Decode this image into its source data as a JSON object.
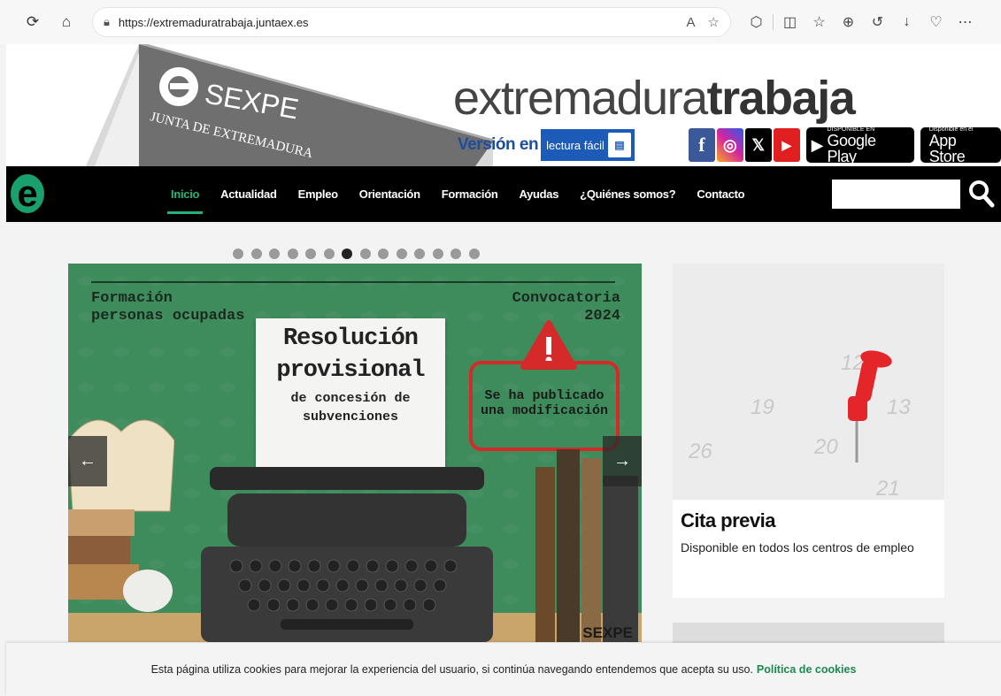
{
  "browser": {
    "url": "https://extremaduratrabaja.juntaex.es"
  },
  "header": {
    "brand_light": "extremadura",
    "brand_bold": "trabaja",
    "sign_line1": "SEXPE",
    "sign_line2": "JUNTA DE EXTREMADURA",
    "easy_read_prefix": "Versión en",
    "easy_read_badge": "lectura fácil",
    "google_small": "DISPONIBLE EN",
    "google_big": "Google Play",
    "apple_small": "Disponible en el",
    "apple_big": "App Store"
  },
  "nav": {
    "items": [
      {
        "label": "Inicio",
        "active": true
      },
      {
        "label": "Actualidad"
      },
      {
        "label": "Empleo"
      },
      {
        "label": "Orientación"
      },
      {
        "label": "Formación"
      },
      {
        "label": "Ayudas"
      },
      {
        "label": "¿Quiénes somos?"
      },
      {
        "label": "Contacto"
      }
    ],
    "search_value": ""
  },
  "carousel": {
    "total_slides": 14,
    "active_index": 6,
    "slide": {
      "left_line1": "Formación",
      "left_line2": "personas ocupadas",
      "right_line1": "Convocatoria",
      "right_line2": "2024",
      "paper_line1": "Resolución",
      "paper_line2": "provisional",
      "paper_line3": "de concesión de",
      "paper_line4": "subvenciones",
      "warn_line1": "Se ha publicado",
      "warn_line2": "una modificación",
      "logo": "SEXPE"
    }
  },
  "side_card": {
    "title": "Cita previa",
    "description": "Disponible en todos los centros de empleo",
    "calendar_numbers": [
      "12",
      "13",
      "19",
      "20",
      "26",
      "21"
    ]
  },
  "cookie": {
    "text": "Esta página utiliza cookies para mejorar la experiencia del usuario, si continúa navegando entendemos que acepta su uso.",
    "link": "Política de cookies"
  },
  "colors": {
    "accent_green": "#26b374",
    "slide_green": "#3e8b5c",
    "warn_red": "#d42a2a"
  }
}
